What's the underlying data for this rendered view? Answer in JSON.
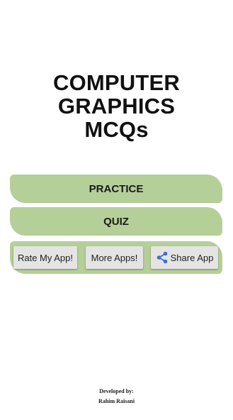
{
  "app": {
    "title_lines": [
      "COMPUTER",
      "GRAPHICS",
      "MCQs"
    ]
  },
  "menu": {
    "practice_label": "PRACTICE",
    "quiz_label": "QUIZ"
  },
  "actions": {
    "rate_label": "Rate My App!",
    "more_label": "More Apps!",
    "share_label": "Share App",
    "share_icon": "share-icon"
  },
  "footer": {
    "developed_by": "Developed by:",
    "developer_name": "Rahim Raisani"
  },
  "colors": {
    "accent_green": "#b5cf99",
    "button_gray": "#e4e4e4",
    "share_blue": "#3d6fd6"
  }
}
